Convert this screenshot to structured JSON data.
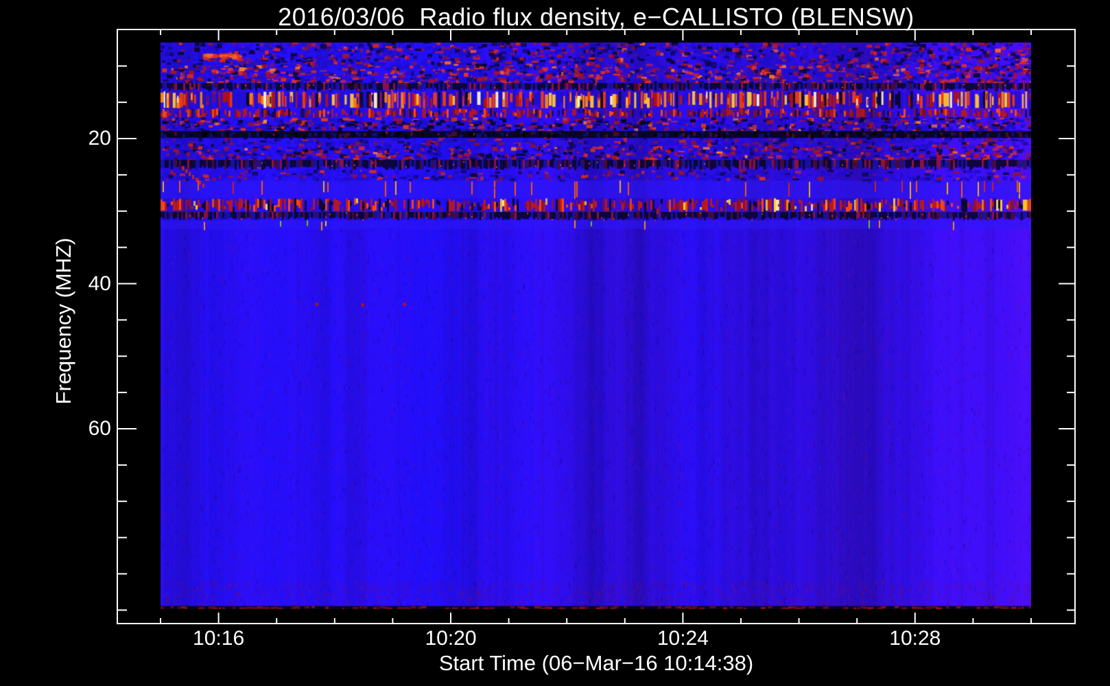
{
  "page": {
    "background": "#000000",
    "foreground": "#ffffff"
  },
  "chart_data": {
    "type": "heatmap",
    "title": "2016/03/06  Radio flux density, e−CALLISTO (BLENSW)",
    "xlabel": "Start Time (06−Mar−16 10:14:38)",
    "ylabel": "Frequency (MHZ)",
    "legend": "none",
    "grid": "off",
    "axis_color": "#ffffff",
    "background_color": "#000000",
    "x_axis": {
      "unit": "time (UT, HH:MM)",
      "data_range_minutes": [
        15,
        30
      ],
      "minor_tick_minutes": [
        15,
        16,
        17,
        18,
        19,
        20,
        21,
        22,
        23,
        24,
        25,
        26,
        27,
        28,
        29,
        30
      ],
      "major_ticks": [
        {
          "minute": 16,
          "label": "10:16"
        },
        {
          "minute": 20,
          "label": "10:20"
        },
        {
          "minute": 24,
          "label": "10:24"
        },
        {
          "minute": 28,
          "label": "10:28"
        }
      ]
    },
    "y_axis": {
      "unit": "MHz",
      "data_range_mhz": [
        6.8,
        84.9
      ],
      "major_ticks": [
        {
          "value": 20,
          "label": "20"
        },
        {
          "value": 40,
          "label": "40"
        },
        {
          "value": 60,
          "label": "60"
        }
      ],
      "minor_tick_values": [
        10,
        15,
        25,
        30,
        35,
        45,
        50,
        55,
        65,
        70,
        75,
        80,
        85
      ]
    },
    "palette": {
      "base_blue": "#2512ec",
      "purple": "#6a1cc8",
      "dark": "#05041c",
      "dark_red": "#8c1030",
      "red": "#d41b10",
      "bright_red": "#ff4500",
      "orange": "#ff8413",
      "yellow": "#ffc62e",
      "pale_yellow": "#fff3c2",
      "green": "#7ac814"
    },
    "bands": [
      {
        "name": "top-mottle",
        "freq": [
          6.76,
          9.79
        ],
        "type": "mottle",
        "density": 0.5,
        "colors": [
          [
            "#1c0ecb",
            5
          ],
          [
            "#0a0536",
            2.5
          ],
          [
            "#971330",
            1.6
          ],
          [
            "#e02413",
            1.0
          ],
          [
            "#ff6a1e",
            0.2
          ]
        ]
      },
      {
        "name": "red-mottle",
        "freq": [
          9.79,
          12.34
        ],
        "type": "mottle",
        "density": 0.65,
        "colors": [
          [
            "#1c0ecb",
            3.5
          ],
          [
            "#0a0536",
            1.5
          ],
          [
            "#a81228",
            2.2
          ],
          [
            "#e8321a",
            1.6
          ],
          [
            "#ff7a28",
            0.35
          ]
        ]
      },
      {
        "name": "dark-dotted-1",
        "freq": [
          12.34,
          13.47
        ],
        "type": "dark_dotted",
        "density": 0.9,
        "colors": [
          [
            "#06051f",
            5
          ],
          [
            "#141099",
            2.2
          ],
          [
            "#480b22",
            1.3
          ],
          [
            "#9c1128",
            0.8
          ]
        ]
      },
      {
        "name": "bright-rfi-line",
        "freq": [
          13.47,
          15.84
        ],
        "type": "bright_dash",
        "density": 0.85,
        "colors": [
          [
            "#b31210",
            2.2
          ],
          [
            "#f23b0a",
            2.2
          ],
          [
            "#ff8413",
            1.6
          ],
          [
            "#ffc62e",
            1.1
          ],
          [
            "#fff3c2",
            0.5
          ],
          [
            "#1b10c8",
            1.2
          ],
          [
            "#0a0630",
            0.6
          ]
        ]
      },
      {
        "name": "red-band",
        "freq": [
          15.84,
          17.16
        ],
        "type": "red_band",
        "density": 0.75,
        "colors": [
          [
            "#bb180f",
            4
          ],
          [
            "#ff4e00",
            1.6
          ],
          [
            "#7c0f26",
            2.4
          ],
          [
            "#140a58",
            1.6
          ]
        ]
      },
      {
        "name": "mottle-dark-patch",
        "freq": [
          17.16,
          18.96
        ],
        "type": "mottle",
        "density": 0.6,
        "colors": [
          [
            "#1c0ecb",
            4
          ],
          [
            "#05041c",
            2.8
          ],
          [
            "#a01228",
            1.8
          ],
          [
            "#ef3a12",
            1.0
          ],
          [
            "#ff8c20",
            0.25
          ]
        ]
      },
      {
        "name": "dark-band",
        "freq": [
          18.96,
          19.91
        ],
        "type": "dark_band",
        "density": 0.9,
        "colors": [
          [
            "#070722",
            5
          ],
          [
            "#101080",
            2
          ],
          [
            "#5a0c24",
            1
          ],
          [
            "#000008",
            2
          ]
        ]
      },
      {
        "name": "blue-mottle",
        "freq": [
          19.91,
          21.04
        ],
        "type": "mottle",
        "density": 0.4,
        "colors": [
          [
            "#1c0ecb",
            5
          ],
          [
            "#0d0742",
            1.6
          ],
          [
            "#8e1126",
            1.4
          ],
          [
            "#d42a12",
            0.7
          ]
        ]
      },
      {
        "name": "red-speckle",
        "freq": [
          21.04,
          22.93
        ],
        "type": "mottle",
        "density": 0.55,
        "colors": [
          [
            "#1a0dbd",
            4
          ],
          [
            "#08052c",
            2
          ],
          [
            "#a81228",
            2.4
          ],
          [
            "#e5301a",
            1.4
          ],
          [
            "#ff8428",
            0.2
          ]
        ]
      },
      {
        "name": "dark-dotted-2",
        "freq": [
          22.93,
          24.35
        ],
        "type": "dark_dotted",
        "density": 0.9,
        "colors": [
          [
            "#06051f",
            5
          ],
          [
            "#141099",
            2.2
          ],
          [
            "#480b22",
            1.3
          ],
          [
            "#9c1128",
            0.8
          ]
        ]
      },
      {
        "name": "blue-mottle-2",
        "freq": [
          24.35,
          25.77
        ],
        "type": "mottle",
        "density": 0.35,
        "colors": [
          [
            "#1c0ecb",
            5
          ],
          [
            "#0d0742",
            1.4
          ],
          [
            "#971330",
            1.5
          ],
          [
            "#dd2f12",
            0.8
          ]
        ]
      },
      {
        "name": "blue-with-ticks",
        "freq": [
          25.77,
          28.23
        ],
        "type": "blue_ticks",
        "density": 0.06,
        "colors": [
          [
            "#ff5a00",
            3
          ],
          [
            "#ffb400",
            1.3
          ],
          [
            "#e02010",
            1
          ]
        ]
      },
      {
        "name": "orange-dash-line",
        "freq": [
          28.23,
          30.12
        ],
        "type": "red_dash",
        "density": 0.8,
        "colors": [
          [
            "#c21a0e",
            3
          ],
          [
            "#ff4e00",
            1.4
          ],
          [
            "#8c1030",
            2
          ],
          [
            "#0a0626",
            1.8
          ],
          [
            "#ffd21e",
            0.35
          ],
          [
            "#fff0a0",
            0.15
          ]
        ]
      },
      {
        "name": "dark-dotted-3",
        "freq": [
          30.12,
          31.25
        ],
        "type": "dark_dotted",
        "density": 0.9,
        "colors": [
          [
            "#06051f",
            5
          ],
          [
            "#141099",
            2.2
          ],
          [
            "#480b22",
            1.3
          ],
          [
            "#9c1128",
            0.8
          ]
        ]
      },
      {
        "name": "tick-tail-row",
        "freq": [
          31.25,
          32.48
        ],
        "type": "blue_ticks",
        "density": 0.035,
        "colors": [
          [
            "#ff9000",
            2.5
          ],
          [
            "#7ac814",
            1.5
          ],
          [
            "#ffd000",
            1
          ]
        ]
      },
      {
        "name": "quiet-blue",
        "freq": [
          32.48,
          84.44
        ],
        "type": "smooth",
        "density": 0.08,
        "colors": [
          [
            "#7a20c0",
            2
          ],
          [
            "#901038",
            2.2
          ],
          [
            "#2020ff",
            3
          ],
          [
            "#050530",
            1.2
          ]
        ]
      },
      {
        "name": "bottom-edge-strip",
        "freq": [
          84.44,
          84.87
        ],
        "type": "bottom_strip",
        "density": 0.5,
        "colors": [
          [
            "#6e0d18",
            3
          ],
          [
            "#a01010",
            1
          ]
        ]
      }
    ],
    "features": {
      "red_streak": {
        "time": [
          15.72,
          16.32
        ],
        "freq": [
          8.2,
          8.75
        ],
        "colors": [
          "#e83410",
          "#ff6a30"
        ]
      },
      "drifting_burst": {
        "time": [
          15.37,
          15.78
        ],
        "freq": [
          23.8,
          26.6
        ],
        "color": "#d8280f"
      },
      "faint_dots": {
        "points": [
          [
            17.67,
            42.6
          ],
          [
            18.46,
            42.7
          ],
          [
            19.18,
            42.6
          ]
        ],
        "color": "#b81414"
      },
      "faint_vertical_lines": {
        "times": [
          18.5,
          21.57,
          24.79
        ],
        "color": "#7a0020"
      }
    }
  }
}
